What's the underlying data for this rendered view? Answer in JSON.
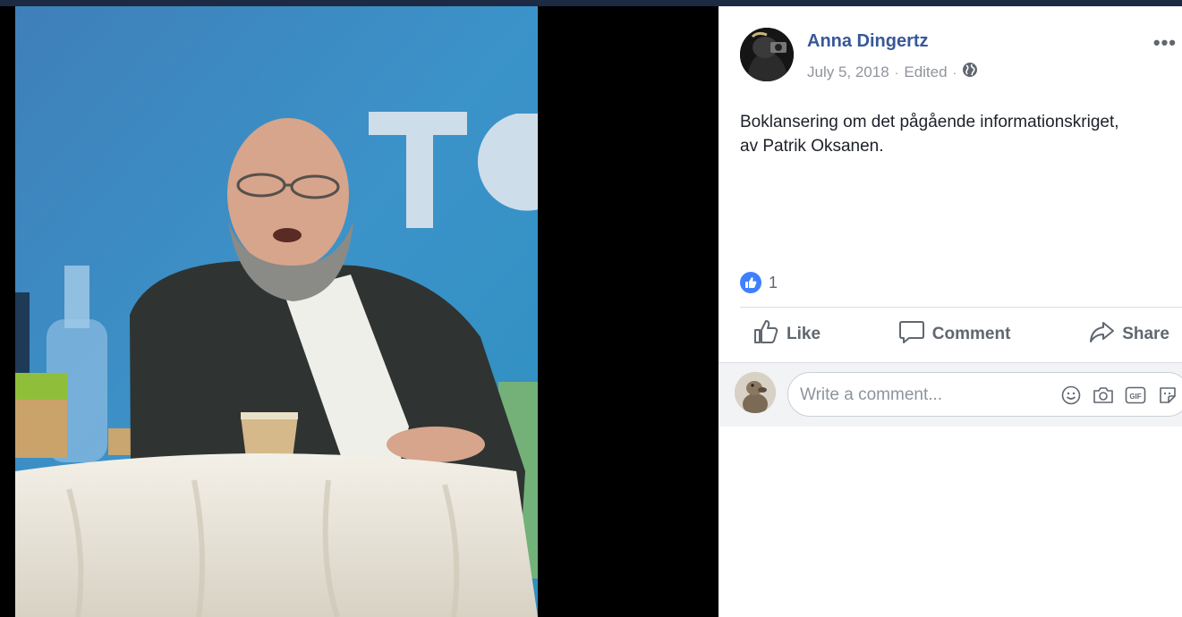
{
  "post": {
    "author": "Anna Dingertz",
    "date": "July 5, 2018",
    "edited": "Edited",
    "separator": "·",
    "text_line1": "Boklansering om det pågående informationskriget,",
    "text_line2": "av Patrik Oksanen.",
    "like_count": "1"
  },
  "actions": {
    "like": "Like",
    "comment": "Comment",
    "share": "Share"
  },
  "comment_box": {
    "placeholder": "Write a comment..."
  },
  "icons": {
    "privacy": "globe-icon",
    "more": "more-options-icon",
    "reaction": "like-reaction-icon",
    "emoji": "emoji-icon",
    "camera": "camera-icon",
    "gif": "gif-icon",
    "sticker": "sticker-icon"
  },
  "colors": {
    "link": "#365899",
    "meta": "#90949c",
    "action": "#606770",
    "like_badge": "#4080ff"
  }
}
